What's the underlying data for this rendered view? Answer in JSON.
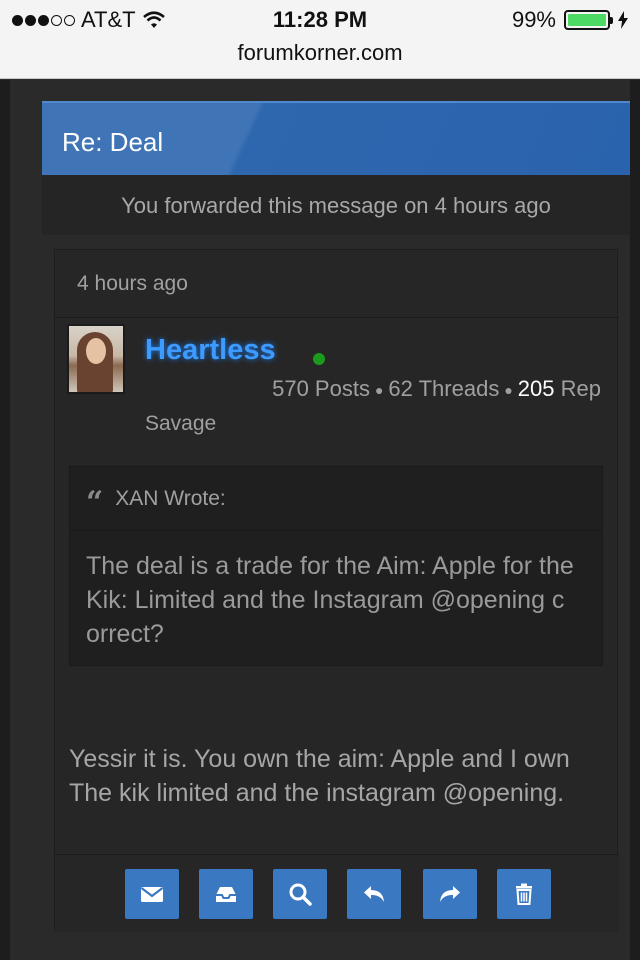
{
  "status_bar": {
    "carrier": "AT&T",
    "time": "11:28 PM",
    "battery": "99%",
    "battery_level": 0.99,
    "url": "forumkorner.com"
  },
  "thread": {
    "title": "Re: Deal",
    "forward_note": "You forwarded this message on 4 hours ago"
  },
  "post": {
    "timestamp": "4 hours ago",
    "username": "Heartless",
    "posts": "570 Posts",
    "threads": "62 Threads",
    "rep_value": "205",
    "rep_label": "Rep",
    "user_title": "Savage",
    "quote": {
      "header": "XAN Wrote:",
      "text": "The deal is a trade for the Aim: Apple for the Kik: Limited and the Instagram @opening correct?"
    },
    "message": "Yessir it is. You own the aim: Apple and I own The kik limited and the instagram @opening."
  },
  "toolbar": {
    "buttons": [
      "mail-icon",
      "inbox-icon",
      "search-icon",
      "reply-icon",
      "forward-icon",
      "trash-icon"
    ]
  },
  "colors": {
    "accent": "#3a78c2",
    "username": "#3d9bff",
    "online": "#1c9a1c"
  }
}
